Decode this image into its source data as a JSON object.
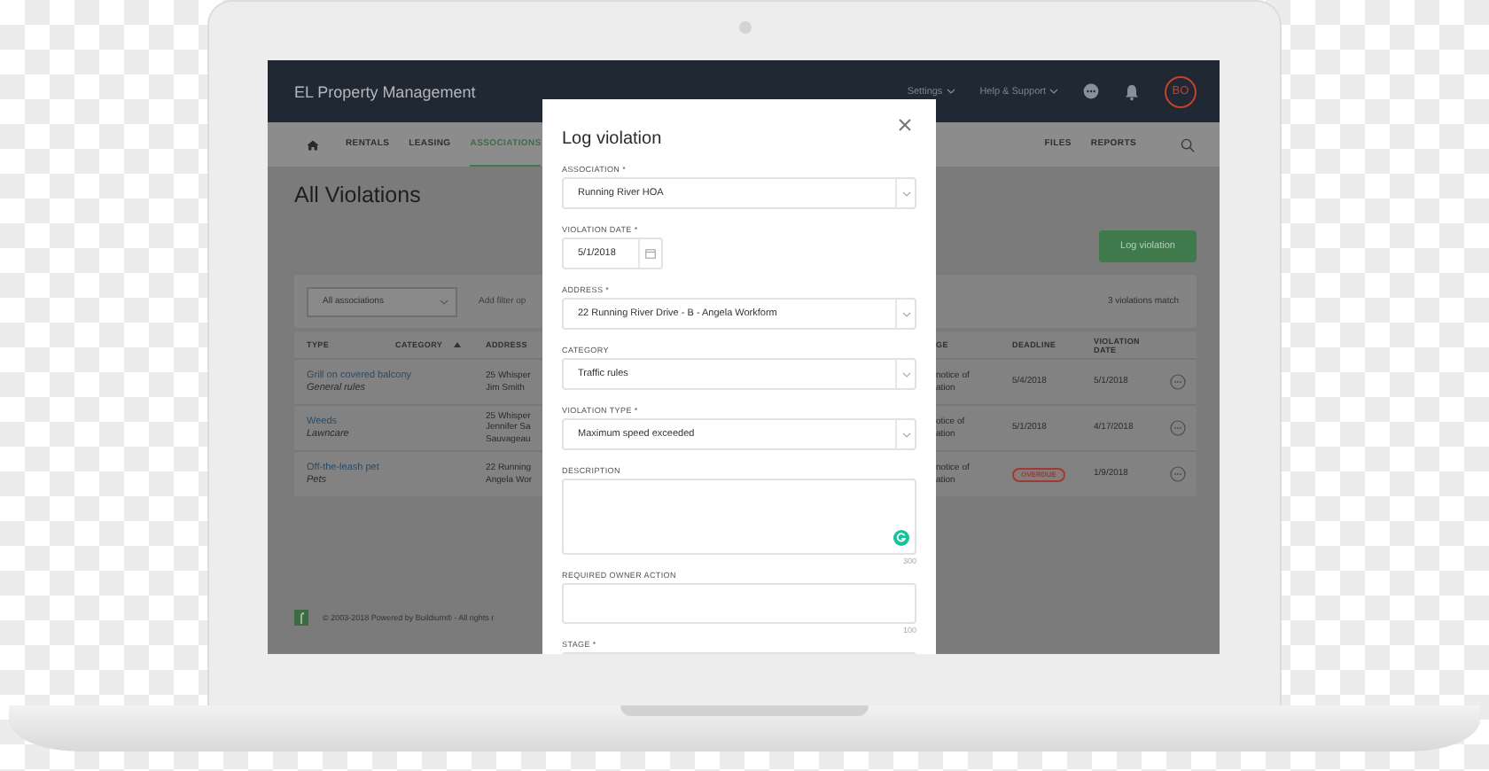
{
  "header": {
    "title": "EL Property Management",
    "menus": [
      {
        "label": "Settings"
      },
      {
        "label": "Help & Support"
      }
    ],
    "avatar": "BO"
  },
  "nav": {
    "left": [
      {
        "label": "RENTALS",
        "selected": false
      },
      {
        "label": "LEASING",
        "selected": false
      },
      {
        "label": "ASSOCIATIONS",
        "selected": true
      }
    ],
    "right": [
      {
        "label": "FILES",
        "selected": false
      },
      {
        "label": "REPORTS",
        "selected": false
      }
    ]
  },
  "page": {
    "title": "All Violations",
    "action": "Log violation"
  },
  "filter": {
    "select": "All associations",
    "placeholder": "Add filter op",
    "count": "3 violations match"
  },
  "table": {
    "columns": [
      {
        "label": "TYPE",
        "sorted": false
      },
      {
        "label": "CATEGORY",
        "sorted": true
      },
      {
        "label": "ADDRESS",
        "sorted": false
      },
      {
        "label": "GE",
        "sorted": false
      },
      {
        "label": "DEADLINE",
        "sorted": false
      },
      {
        "label": "VIOLATION DATE",
        "sorted": false
      }
    ],
    "rows": [
      {
        "type": "Grill on covered balcony",
        "category": "General rules",
        "address": [
          "25 Whisper",
          "Jim Smith"
        ],
        "stage": [
          "notice of",
          "ation"
        ],
        "deadline": {
          "text": "5/4/2018",
          "overdue": false
        },
        "violation_date": "5/1/2018"
      },
      {
        "type": "Weeds",
        "category": "Lawncare",
        "address": [
          "25 Whisper",
          "Jennifer Sa",
          "Sauvageau"
        ],
        "stage": [
          "otice of",
          "ation"
        ],
        "deadline": {
          "text": "5/1/2018",
          "overdue": false
        },
        "violation_date": "4/17/2018"
      },
      {
        "type": "Off-the-leash pet",
        "category": "Pets",
        "address": [
          "22 Running",
          "Angela Wor"
        ],
        "stage": [
          "notice of",
          "ation"
        ],
        "deadline": {
          "text": "OVERDUE",
          "overdue": true
        },
        "violation_date": "1/9/2018"
      }
    ]
  },
  "footer": "© 2003-2018 Powered by Buildium® - All rights r",
  "modal": {
    "title": "Log violation",
    "fields": [
      {
        "kind": "select",
        "label": "ASSOCIATION *",
        "value": "Running River HOA"
      },
      {
        "kind": "date",
        "label": "VIOLATION DATE *",
        "value": "5/1/2018"
      },
      {
        "kind": "select",
        "label": "ADDRESS *",
        "value": "22 Running River Drive - B - Angela Workform"
      },
      {
        "kind": "select",
        "label": "CATEGORY",
        "value": "Traffic rules"
      },
      {
        "kind": "select",
        "label": "VIOLATION TYPE *",
        "value": "Maximum speed exceeded"
      },
      {
        "kind": "textarea",
        "label": "DESCRIPTION",
        "counter": "300",
        "grammar": true
      },
      {
        "kind": "textarea",
        "label": "REQUIRED OWNER ACTION",
        "counter": "100",
        "grammar": false
      },
      {
        "kind": "select",
        "label": "STAGE *"
      }
    ]
  }
}
